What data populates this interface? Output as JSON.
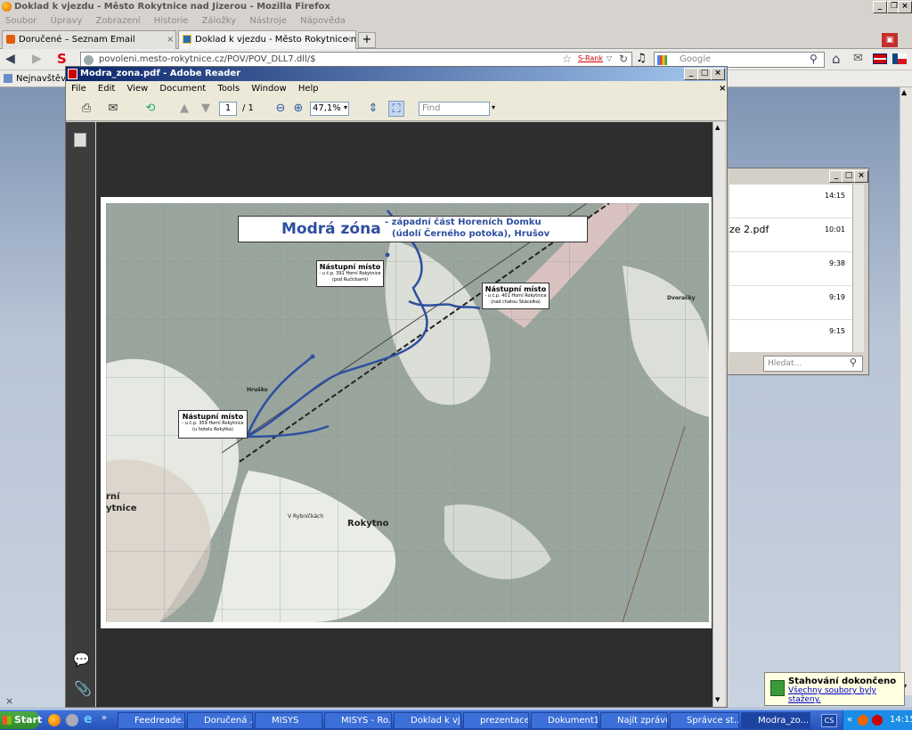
{
  "firefox": {
    "window_title": "Doklad k vjezdu - Město Rokytnice nad Jizerou - Mozilla Firefox",
    "menu": [
      "Soubor",
      "Úpravy",
      "Zobrazení",
      "Historie",
      "Záložky",
      "Nástroje",
      "Nápověda"
    ],
    "tabs": [
      {
        "label": "Doručené – Seznam Email"
      },
      {
        "label": "Doklad k vjezdu - Město Rokytnice nad Ji..."
      }
    ],
    "url": "povoleni.mesto-rokytnice.cz/POV/POV_DLL7.dll/$",
    "srank": "S-Rank",
    "search_placeholder": "Google",
    "bookmark": "Nejnavštěvov"
  },
  "reader": {
    "window_title": "Modra_zona.pdf - Adobe Reader",
    "menu": [
      "File",
      "Edit",
      "View",
      "Document",
      "Tools",
      "Window",
      "Help"
    ],
    "page_current": "1",
    "page_total": "/ 1",
    "zoom": "47,1%",
    "find_placeholder": "Find"
  },
  "map": {
    "title": "Modrá zóna",
    "subtitle_line1": "- západní část Horeních Domku",
    "subtitle_line2": "(údolí Černého potoka), Hrušov",
    "boxes": [
      {
        "title": "Nástupní místo",
        "line1": "- u č.p. 391 Horní Rokytnice",
        "line2": "(pod Ručickami)"
      },
      {
        "title": "Nástupní místo",
        "line1": "- u č.p. 401 Horní Rokytnice",
        "line2": "(nad chatou Skácelka)"
      },
      {
        "title": "Nástupní místo",
        "line1": "- u č.p. 359 Horní Rokytnice",
        "line2": "(u hotelu Rokytka)"
      }
    ],
    "place_labels": [
      "Rokytno",
      "rní",
      "ytnice",
      "Dvoračky",
      "Hruško",
      "V Rybníčkách"
    ],
    "route_color": "#2e4fa0"
  },
  "mail_window": {
    "times": [
      "14:15",
      "10:01",
      "9:38",
      "9:19",
      "9:15"
    ],
    "file_fragment": "ze 2.pdf",
    "search_placeholder": "Hledat..."
  },
  "notification": {
    "title": "Stahování dokončeno",
    "text": "Všechny soubory byly staženy."
  },
  "taskbar": {
    "start": "Start",
    "tasks": [
      "Feedreade...",
      "Doručená ...",
      "MISYS",
      "MISYS - Ro...",
      "Doklad k vj...",
      "prezentace",
      "Dokument1...",
      "Najít zprávu",
      "Správce st...",
      "Modra_zo..."
    ],
    "lang": "CS",
    "clock": "14:15"
  }
}
